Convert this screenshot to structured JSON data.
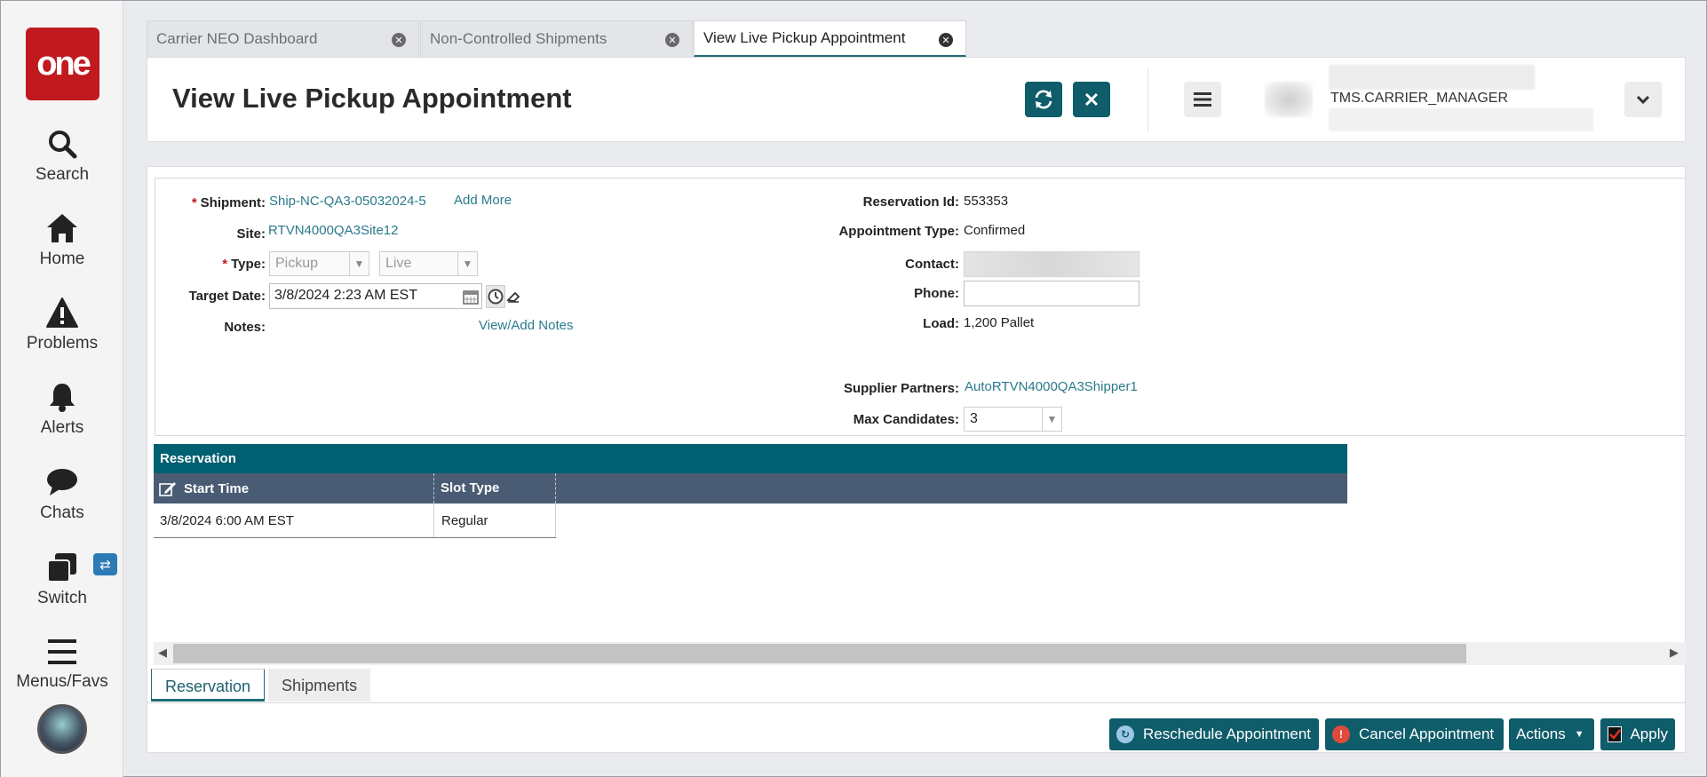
{
  "nav": {
    "logo": "one",
    "items": [
      {
        "label": "Search",
        "icon": "search-icon"
      },
      {
        "label": "Home",
        "icon": "home-icon"
      },
      {
        "label": "Problems",
        "icon": "warning-icon"
      },
      {
        "label": "Alerts",
        "icon": "bell-icon"
      },
      {
        "label": "Chats",
        "icon": "chat-icon"
      },
      {
        "label": "Switch",
        "icon": "switch-icon"
      },
      {
        "label": "Menus/Favs",
        "icon": "menu-icon"
      }
    ]
  },
  "tabs": [
    {
      "label": "Carrier NEO Dashboard",
      "active": false
    },
    {
      "label": "Non-Controlled Shipments",
      "active": false
    },
    {
      "label": "View Live Pickup Appointment",
      "active": true
    }
  ],
  "header": {
    "title": "View Live Pickup Appointment",
    "user": "TMS.CARRIER_MANAGER"
  },
  "form": {
    "shipment_label": "Shipment:",
    "shipment_value": "Ship-NC-QA3-05032024-5",
    "add_more": "Add More",
    "site_label": "Site:",
    "site_value": "RTVN4000QA3Site12",
    "type_label": "Type:",
    "type_value": "Pickup",
    "mode_value": "Live",
    "target_date_label": "Target Date:",
    "target_date_value": "3/8/2024 2:23 AM EST",
    "notes_label": "Notes:",
    "notes_link": "View/Add Notes",
    "reservation_id_label": "Reservation Id:",
    "reservation_id_value": "553353",
    "appointment_type_label": "Appointment Type:",
    "appointment_type_value": "Confirmed",
    "contact_label": "Contact:",
    "phone_label": "Phone:",
    "phone_value": "",
    "load_label": "Load:",
    "load_value": "1,200 Pallet",
    "supplier_partners_label": "Supplier Partners:",
    "supplier_partners_value": "AutoRTVN4000QA3Shipper1",
    "max_candidates_label": "Max Candidates:",
    "max_candidates_value": "3"
  },
  "grid": {
    "title": "Reservation",
    "columns": [
      "Start Time",
      "Slot Type"
    ],
    "rows": [
      [
        "3/8/2024 6:00 AM EST",
        "Regular"
      ]
    ]
  },
  "bottom_tabs": [
    {
      "label": "Reservation",
      "active": true
    },
    {
      "label": "Shipments",
      "active": false
    }
  ],
  "footer": {
    "reschedule": "Reschedule Appointment",
    "cancel": "Cancel Appointment",
    "actions": "Actions",
    "apply": "Apply"
  },
  "colors": {
    "brand_red": "#c0191e",
    "teal": "#0f5c6a",
    "grid_header": "#4a5c74",
    "link": "#2a7a8c"
  }
}
